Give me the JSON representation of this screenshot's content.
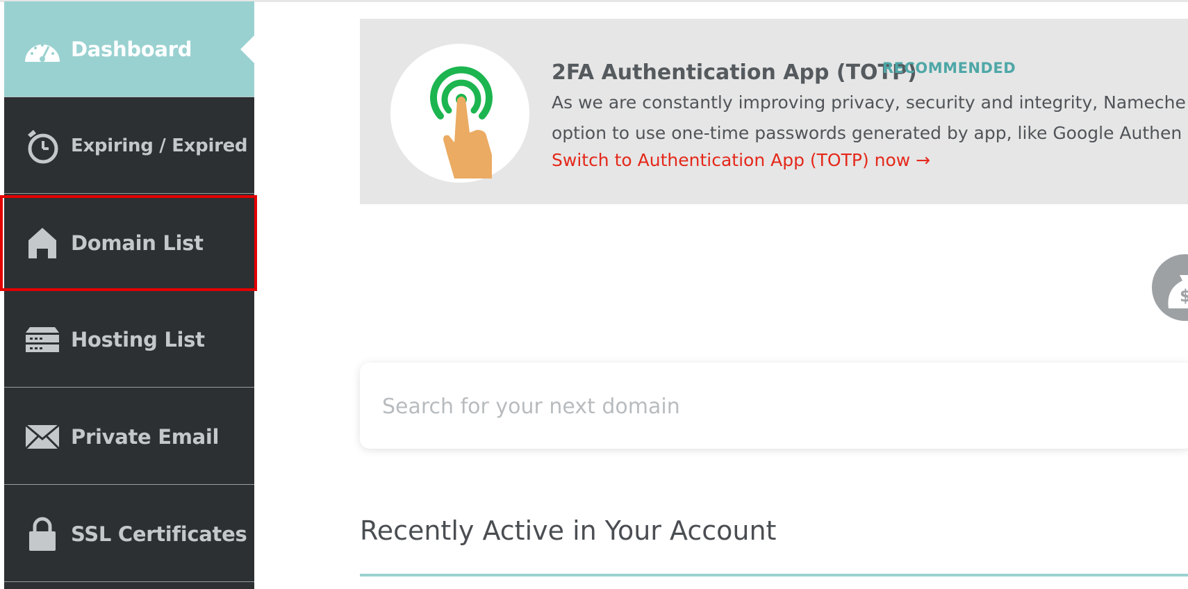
{
  "sidebar": {
    "items": [
      {
        "label": "Dashboard",
        "icon": "speedometer-icon"
      },
      {
        "label": "Expiring / Expired",
        "icon": "stopwatch-icon"
      },
      {
        "label": "Domain List",
        "icon": "house-icon"
      },
      {
        "label": "Hosting List",
        "icon": "server-icon"
      },
      {
        "label": "Private Email",
        "icon": "envelope-icon"
      },
      {
        "label": "SSL Certificates",
        "icon": "padlock-icon"
      }
    ],
    "active_item": "Dashboard",
    "highlighted_item": "Domain List",
    "colors": {
      "background": "#2d3033",
      "active": "#99d1d0",
      "highlight_outline": "#e30000"
    }
  },
  "banner": {
    "title": "2FA Authentication App (TOTP)",
    "tag": "RECOMMENDED",
    "text_line1": "As we are constantly improving privacy, security and integrity, Nameche",
    "text_line2": "option to use one-time passwords generated by app, like Google Authen",
    "link": "Switch to Authentication App (TOTP) now →",
    "icon": "touch-hand-icon",
    "colors": {
      "link": "#e4281a",
      "tag": "#4fa7a7",
      "background": "#e6e6e6"
    }
  },
  "search": {
    "placeholder": "Search for your next domain"
  },
  "side_icon": "money-bag-icon",
  "recent": {
    "title": "Recently Active in Your Account"
  }
}
